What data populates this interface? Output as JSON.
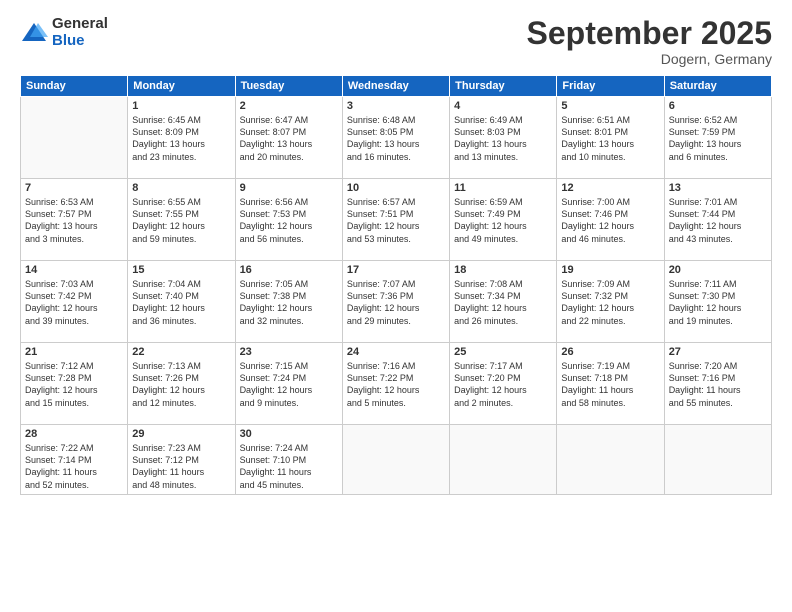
{
  "logo": {
    "general": "General",
    "blue": "Blue"
  },
  "title": "September 2025",
  "subtitle": "Dogern, Germany",
  "days": [
    "Sunday",
    "Monday",
    "Tuesday",
    "Wednesday",
    "Thursday",
    "Friday",
    "Saturday"
  ],
  "weeks": [
    [
      {
        "day": "",
        "content": ""
      },
      {
        "day": "1",
        "content": "Sunrise: 6:45 AM\nSunset: 8:09 PM\nDaylight: 13 hours\nand 23 minutes."
      },
      {
        "day": "2",
        "content": "Sunrise: 6:47 AM\nSunset: 8:07 PM\nDaylight: 13 hours\nand 20 minutes."
      },
      {
        "day": "3",
        "content": "Sunrise: 6:48 AM\nSunset: 8:05 PM\nDaylight: 13 hours\nand 16 minutes."
      },
      {
        "day": "4",
        "content": "Sunrise: 6:49 AM\nSunset: 8:03 PM\nDaylight: 13 hours\nand 13 minutes."
      },
      {
        "day": "5",
        "content": "Sunrise: 6:51 AM\nSunset: 8:01 PM\nDaylight: 13 hours\nand 10 minutes."
      },
      {
        "day": "6",
        "content": "Sunrise: 6:52 AM\nSunset: 7:59 PM\nDaylight: 13 hours\nand 6 minutes."
      }
    ],
    [
      {
        "day": "7",
        "content": "Sunrise: 6:53 AM\nSunset: 7:57 PM\nDaylight: 13 hours\nand 3 minutes."
      },
      {
        "day": "8",
        "content": "Sunrise: 6:55 AM\nSunset: 7:55 PM\nDaylight: 12 hours\nand 59 minutes."
      },
      {
        "day": "9",
        "content": "Sunrise: 6:56 AM\nSunset: 7:53 PM\nDaylight: 12 hours\nand 56 minutes."
      },
      {
        "day": "10",
        "content": "Sunrise: 6:57 AM\nSunset: 7:51 PM\nDaylight: 12 hours\nand 53 minutes."
      },
      {
        "day": "11",
        "content": "Sunrise: 6:59 AM\nSunset: 7:49 PM\nDaylight: 12 hours\nand 49 minutes."
      },
      {
        "day": "12",
        "content": "Sunrise: 7:00 AM\nSunset: 7:46 PM\nDaylight: 12 hours\nand 46 minutes."
      },
      {
        "day": "13",
        "content": "Sunrise: 7:01 AM\nSunset: 7:44 PM\nDaylight: 12 hours\nand 43 minutes."
      }
    ],
    [
      {
        "day": "14",
        "content": "Sunrise: 7:03 AM\nSunset: 7:42 PM\nDaylight: 12 hours\nand 39 minutes."
      },
      {
        "day": "15",
        "content": "Sunrise: 7:04 AM\nSunset: 7:40 PM\nDaylight: 12 hours\nand 36 minutes."
      },
      {
        "day": "16",
        "content": "Sunrise: 7:05 AM\nSunset: 7:38 PM\nDaylight: 12 hours\nand 32 minutes."
      },
      {
        "day": "17",
        "content": "Sunrise: 7:07 AM\nSunset: 7:36 PM\nDaylight: 12 hours\nand 29 minutes."
      },
      {
        "day": "18",
        "content": "Sunrise: 7:08 AM\nSunset: 7:34 PM\nDaylight: 12 hours\nand 26 minutes."
      },
      {
        "day": "19",
        "content": "Sunrise: 7:09 AM\nSunset: 7:32 PM\nDaylight: 12 hours\nand 22 minutes."
      },
      {
        "day": "20",
        "content": "Sunrise: 7:11 AM\nSunset: 7:30 PM\nDaylight: 12 hours\nand 19 minutes."
      }
    ],
    [
      {
        "day": "21",
        "content": "Sunrise: 7:12 AM\nSunset: 7:28 PM\nDaylight: 12 hours\nand 15 minutes."
      },
      {
        "day": "22",
        "content": "Sunrise: 7:13 AM\nSunset: 7:26 PM\nDaylight: 12 hours\nand 12 minutes."
      },
      {
        "day": "23",
        "content": "Sunrise: 7:15 AM\nSunset: 7:24 PM\nDaylight: 12 hours\nand 9 minutes."
      },
      {
        "day": "24",
        "content": "Sunrise: 7:16 AM\nSunset: 7:22 PM\nDaylight: 12 hours\nand 5 minutes."
      },
      {
        "day": "25",
        "content": "Sunrise: 7:17 AM\nSunset: 7:20 PM\nDaylight: 12 hours\nand 2 minutes."
      },
      {
        "day": "26",
        "content": "Sunrise: 7:19 AM\nSunset: 7:18 PM\nDaylight: 11 hours\nand 58 minutes."
      },
      {
        "day": "27",
        "content": "Sunrise: 7:20 AM\nSunset: 7:16 PM\nDaylight: 11 hours\nand 55 minutes."
      }
    ],
    [
      {
        "day": "28",
        "content": "Sunrise: 7:22 AM\nSunset: 7:14 PM\nDaylight: 11 hours\nand 52 minutes."
      },
      {
        "day": "29",
        "content": "Sunrise: 7:23 AM\nSunset: 7:12 PM\nDaylight: 11 hours\nand 48 minutes."
      },
      {
        "day": "30",
        "content": "Sunrise: 7:24 AM\nSunset: 7:10 PM\nDaylight: 11 hours\nand 45 minutes."
      },
      {
        "day": "",
        "content": ""
      },
      {
        "day": "",
        "content": ""
      },
      {
        "day": "",
        "content": ""
      },
      {
        "day": "",
        "content": ""
      }
    ]
  ]
}
